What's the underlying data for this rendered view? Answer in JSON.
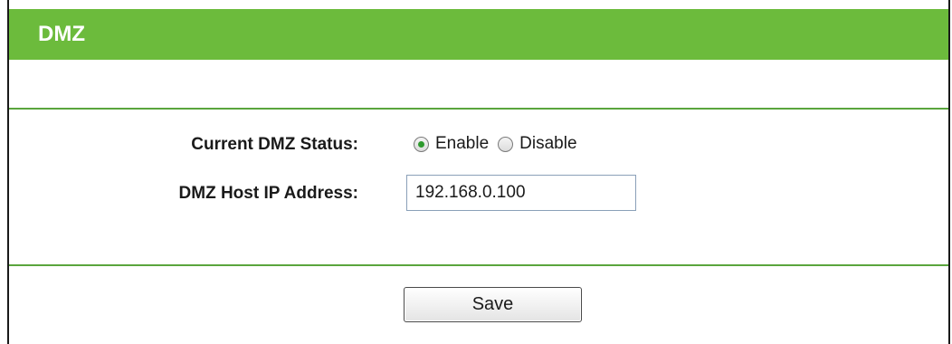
{
  "header": {
    "title": "DMZ"
  },
  "form": {
    "status_label": "Current DMZ Status:",
    "status_options": [
      {
        "label": "Enable",
        "selected": true
      },
      {
        "label": "Disable",
        "selected": false
      }
    ],
    "ip_label": "DMZ Host IP Address:",
    "ip_value": "192.168.0.100"
  },
  "actions": {
    "save_label": "Save"
  },
  "colors": {
    "header_bg": "#6cbb3c",
    "divider": "#5aa53d",
    "radio_dot": "#2e9a2e"
  }
}
